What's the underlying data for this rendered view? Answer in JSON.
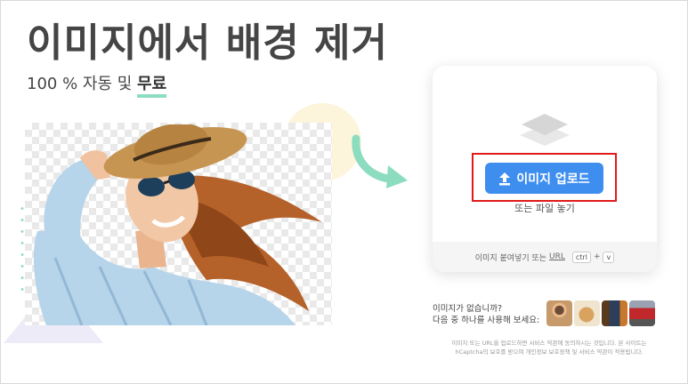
{
  "hero": {
    "title": "이미지에서 배경 제거",
    "subtitle_prefix": "100 % 자동 및 ",
    "subtitle_highlight": "무료"
  },
  "upload_card": {
    "button_label": "이미지 업로드",
    "drop_text": "또는 파일 놓기",
    "paste_text": "이미지 붙여넣기 또는",
    "url_label": "URL",
    "key_ctrl": "ctrl",
    "key_plus": "+",
    "key_v": "v"
  },
  "samples": {
    "line1": "이미지가 없습니까?",
    "line2": "다음 중 하나를 사용해 보세요:",
    "thumbnails": [
      "sample-woman",
      "sample-dog",
      "sample-objects",
      "sample-car"
    ]
  },
  "legal": {
    "line1": "이미지 또는 URL을 업로드하면 서비스 약관에 동의하시는 것입니다. 본 사이트는",
    "line2": "hCaptcha의 보호를 받으며 개인정보 보호정책 및 서비스 약관이 적용됩니다."
  },
  "colors": {
    "accent": "#3e8ef0",
    "highlight_underline": "#8cdcc0",
    "annotation_box": "#e01a1a",
    "arrow": "#8cdcc0"
  }
}
